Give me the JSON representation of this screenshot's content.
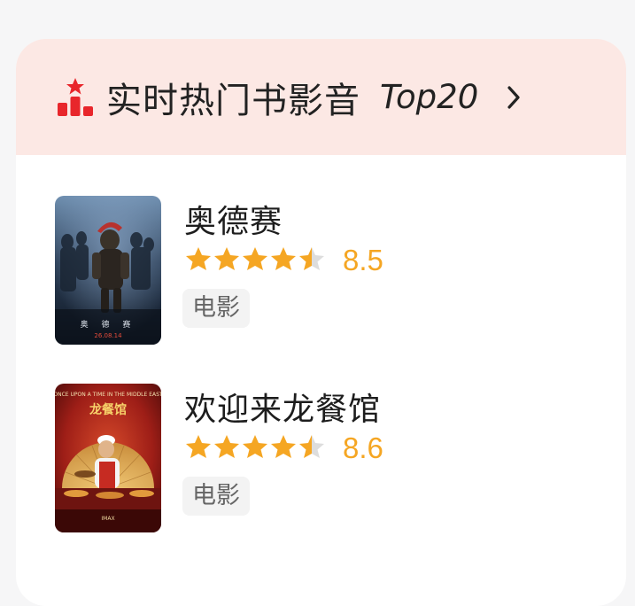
{
  "header": {
    "title": "实时热门书影音",
    "top_label": "Top20",
    "icon": "ranking-icon",
    "chevron_icon": "chevron-right-icon"
  },
  "items": [
    {
      "title": "奥德赛",
      "rating": 8.5,
      "rating_text": "8.5",
      "stars_filled": 4.5,
      "tag": "电影",
      "poster_date": "26.08.14"
    },
    {
      "title": "欢迎来龙餐馆",
      "rating": 8.6,
      "rating_text": "8.6",
      "stars_filled": 4.5,
      "tag": "电影"
    }
  ],
  "colors": {
    "header_bg": "#fce8e4",
    "accent_red": "#e8262b",
    "star": "#f5a623",
    "star_empty": "#dddddd"
  }
}
